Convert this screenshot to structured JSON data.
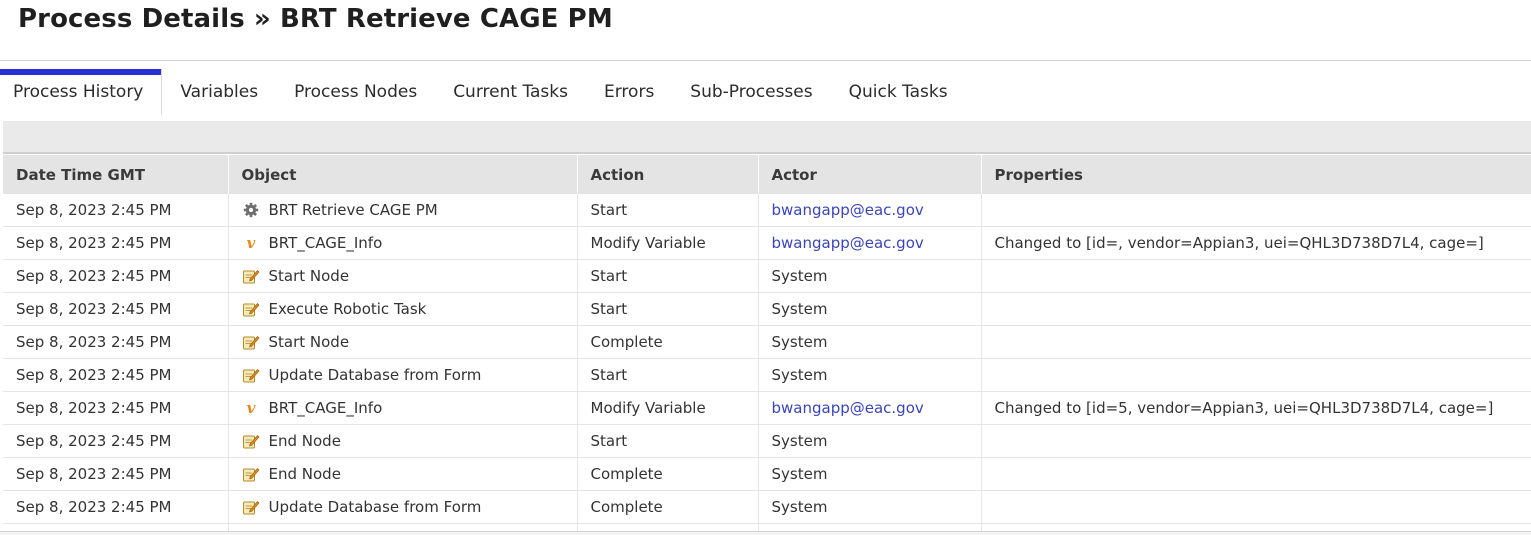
{
  "page": {
    "title": "Process Details » BRT Retrieve CAGE PM"
  },
  "tabs": [
    {
      "label": "Process History",
      "active": true
    },
    {
      "label": "Variables",
      "active": false
    },
    {
      "label": "Process Nodes",
      "active": false
    },
    {
      "label": "Current Tasks",
      "active": false
    },
    {
      "label": "Errors",
      "active": false
    },
    {
      "label": "Sub-Processes",
      "active": false
    },
    {
      "label": "Quick Tasks",
      "active": false
    }
  ],
  "table": {
    "columns": [
      "Date Time GMT",
      "Object",
      "Action",
      "Actor",
      "Properties"
    ],
    "rows": [
      {
        "datetime": "Sep 8, 2023 2:45 PM",
        "object_icon": "gear-icon",
        "object": "BRT Retrieve CAGE PM",
        "action": "Start",
        "actor": "bwangapp@eac.gov",
        "actor_is_link": true,
        "properties": ""
      },
      {
        "datetime": "Sep 8, 2023 2:45 PM",
        "object_icon": "variable-icon",
        "object": "BRT_CAGE_Info",
        "action": "Modify Variable",
        "actor": "bwangapp@eac.gov",
        "actor_is_link": true,
        "properties": "Changed to [id=, vendor=Appian3, uei=QHL3D738D7L4, cage=]"
      },
      {
        "datetime": "Sep 8, 2023 2:45 PM",
        "object_icon": "task-node-icon",
        "object": "Start Node",
        "action": "Start",
        "actor": "System",
        "actor_is_link": false,
        "properties": ""
      },
      {
        "datetime": "Sep 8, 2023 2:45 PM",
        "object_icon": "task-node-icon",
        "object": "Execute Robotic Task",
        "action": "Start",
        "actor": "System",
        "actor_is_link": false,
        "properties": ""
      },
      {
        "datetime": "Sep 8, 2023 2:45 PM",
        "object_icon": "task-node-icon",
        "object": "Start Node",
        "action": "Complete",
        "actor": "System",
        "actor_is_link": false,
        "properties": ""
      },
      {
        "datetime": "Sep 8, 2023 2:45 PM",
        "object_icon": "task-node-icon",
        "object": "Update Database from Form",
        "action": "Start",
        "actor": "System",
        "actor_is_link": false,
        "properties": ""
      },
      {
        "datetime": "Sep 8, 2023 2:45 PM",
        "object_icon": "variable-icon",
        "object": "BRT_CAGE_Info",
        "action": "Modify Variable",
        "actor": "bwangapp@eac.gov",
        "actor_is_link": true,
        "properties": "Changed to [id=5, vendor=Appian3, uei=QHL3D738D7L4, cage=]"
      },
      {
        "datetime": "Sep 8, 2023 2:45 PM",
        "object_icon": "task-node-icon",
        "object": "End Node",
        "action": "Start",
        "actor": "System",
        "actor_is_link": false,
        "properties": ""
      },
      {
        "datetime": "Sep 8, 2023 2:45 PM",
        "object_icon": "task-node-icon",
        "object": "End Node",
        "action": "Complete",
        "actor": "System",
        "actor_is_link": false,
        "properties": ""
      },
      {
        "datetime": "Sep 8, 2023 2:45 PM",
        "object_icon": "task-node-icon",
        "object": "Update Database from Form",
        "action": "Complete",
        "actor": "System",
        "actor_is_link": false,
        "properties": ""
      }
    ]
  },
  "colors": {
    "active_tab_accent": "#2a2fd6",
    "link": "#3a45b8",
    "header_bg": "#e4e4e4",
    "variable_icon": "#e8891c"
  }
}
